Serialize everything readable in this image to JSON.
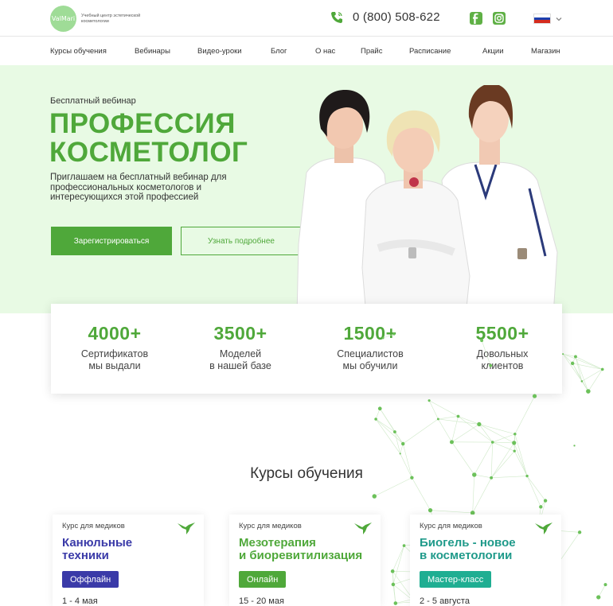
{
  "header": {
    "logo_text": "ValMari",
    "logo_caption": "Учебный центр эстетической косметологии",
    "phone": "0 (800) 508-622",
    "icons": [
      "phone-icon",
      "facebook-icon",
      "instagram-icon",
      "russian-flag-icon",
      "chevron-down-icon"
    ],
    "colors": {
      "brand": "#4fa83a",
      "hero_bg": "#e8fae4"
    }
  },
  "nav": {
    "items": [
      "Курсы обучения",
      "Вебинары",
      "Видео-уроки",
      "Блог",
      "О нас",
      "Прайс",
      "Расписание",
      "Акции",
      "Магазин"
    ]
  },
  "hero": {
    "subtitle": "Бесплатный вебинар",
    "title_line1": "ПРОФЕССИЯ",
    "title_line2": "КОСМЕТОЛОГ",
    "description": "Приглашаем на бесплатный вебинар для профессиональных косметологов и интересующихся этой профессией",
    "primary_button": "Зарегистрироваться",
    "secondary_button": "Узнать подробнее"
  },
  "stats": [
    {
      "number": "4000+",
      "label_line1": "Сертификатов",
      "label_line2": "мы выдали"
    },
    {
      "number": "3500+",
      "label_line1": "Моделей",
      "label_line2": "в нашей базе"
    },
    {
      "number": "1500+",
      "label_line1": "Специалистов",
      "label_line2": "мы обучили"
    },
    {
      "number": "5500+",
      "label_line1": "Довольных",
      "label_line2": "клиентов"
    }
  ],
  "courses": {
    "title": "Курсы обучения",
    "cards": [
      {
        "tag": "Курс для медиков",
        "title_line1": "Канюльные",
        "title_line2": "техники",
        "title_color": "#3a3aa8",
        "badge": "Оффлайн",
        "badge_color": "#3a3aa8",
        "date": "1 - 4 мая"
      },
      {
        "tag": "Курс для медиков",
        "title_line1": "Мезотерапия",
        "title_line2": "и биоревитилизация",
        "title_color": "#4fa83a",
        "badge": "Онлайн",
        "badge_color": "#4fa83a",
        "date": "15 - 20 мая"
      },
      {
        "tag": "Курс для медиков",
        "title_line1": "Биогель - новое",
        "title_line2": "в косметологии",
        "title_color": "#1f9a8a",
        "badge": "Мастер-класс",
        "badge_color": "#1fae92",
        "date": "2 - 5 августа"
      }
    ]
  }
}
